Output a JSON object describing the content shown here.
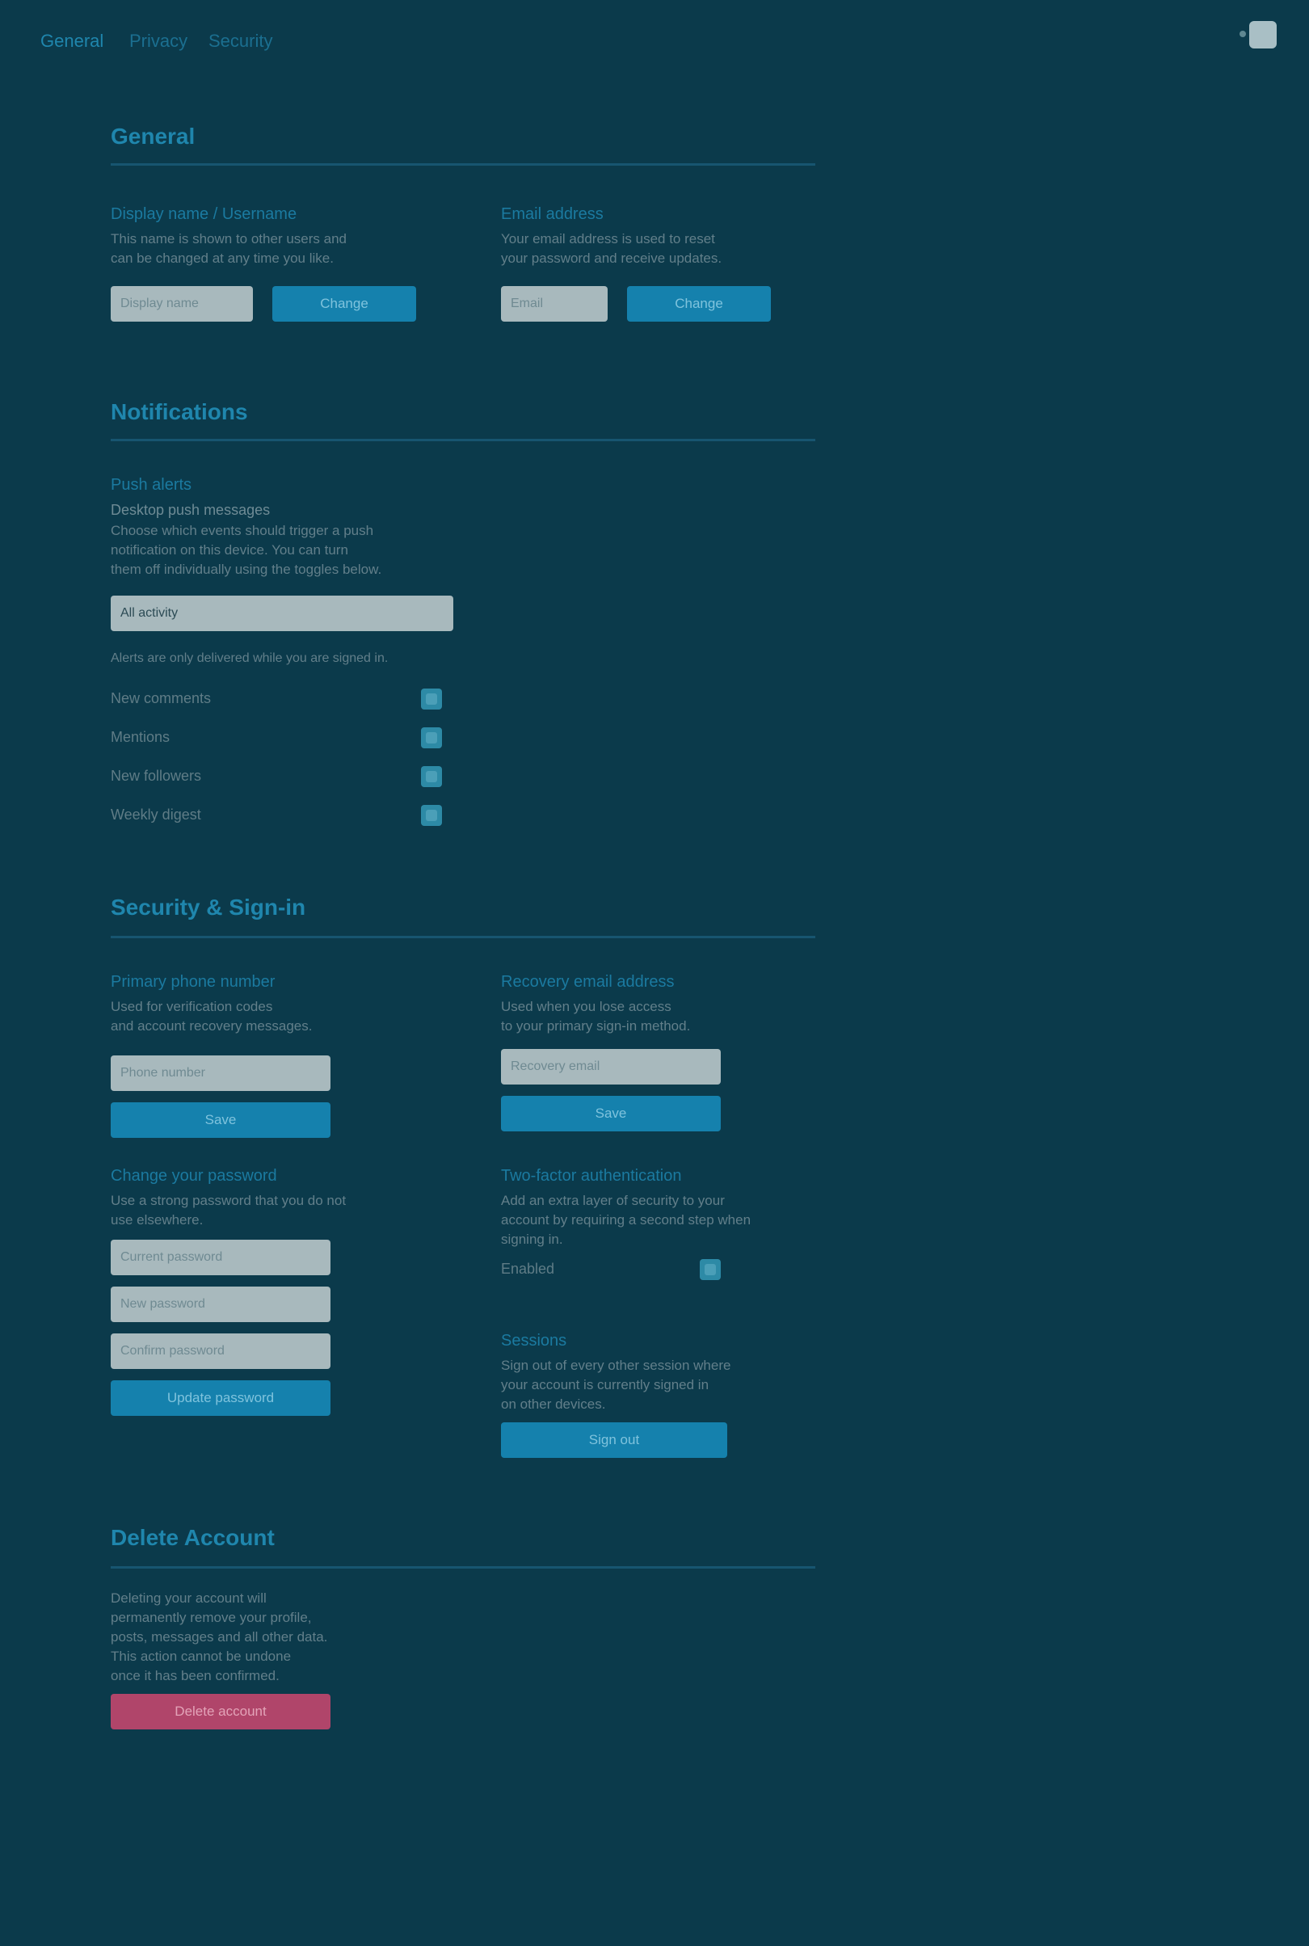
{
  "nav": {
    "links": [
      "General",
      "Privacy",
      "Security"
    ]
  },
  "general": {
    "title": "General",
    "display_name": {
      "heading": "Display name / Username",
      "desc": [
        "This name is shown to other users and",
        "can be changed at any time you like."
      ],
      "input_placeholder": "Display name",
      "button": "Change"
    },
    "email": {
      "heading": "Email address",
      "desc": [
        "Your email address is used to reset",
        "your password and receive updates."
      ],
      "input_placeholder": "Email",
      "button": "Change"
    }
  },
  "notifications": {
    "title": "Notifications",
    "push": {
      "heading": "Push alerts",
      "sub": "Desktop push messages",
      "desc": [
        "Choose which events should trigger a push",
        "notification on this device. You can turn",
        "them off individually using the toggles below."
      ],
      "select_value": "All activity",
      "note": "Alerts are only delivered while you are signed in."
    },
    "toggles": [
      {
        "label": "New comments",
        "on": true
      },
      {
        "label": "Mentions",
        "on": true
      },
      {
        "label": "New followers",
        "on": true
      },
      {
        "label": "Weekly digest",
        "on": true
      }
    ]
  },
  "security": {
    "title": "Security & Sign-in",
    "primary_phone": {
      "heading": "Primary phone number",
      "desc": [
        "Used for verification codes",
        "and account recovery messages."
      ],
      "input_placeholder": "Phone number",
      "button": "Save"
    },
    "recovery_email": {
      "heading": "Recovery email address",
      "desc": [
        "Used when you lose access",
        "to your primary sign-in method."
      ],
      "input_placeholder": "Recovery email",
      "button": "Save"
    },
    "change_password": {
      "heading": "Change your password",
      "desc": [
        "Use a strong password that you do not",
        "use elsewhere."
      ],
      "current_placeholder": "Current password",
      "new_placeholder": "New password",
      "confirm_placeholder": "Confirm password",
      "button": "Update password"
    },
    "two_factor": {
      "heading": "Two-factor authentication",
      "desc": [
        "Add an extra layer of security to your",
        "account by requiring a second step when",
        "signing in."
      ],
      "toggle_label": "Enabled",
      "toggle_on": true
    },
    "sessions": {
      "heading": "Sessions",
      "desc": [
        "Sign out of every other session where",
        "your account is currently signed in",
        "on other devices."
      ],
      "button": "Sign out"
    }
  },
  "delete_account": {
    "title": "Delete Account",
    "desc": [
      "Deleting your account will",
      "permanently remove your profile,",
      "posts, messages and all other data.",
      "This action cannot be undone",
      "once it has been confirmed."
    ],
    "button": "Delete account"
  },
  "colors": {
    "background": "#0b3a4b",
    "accent": "#1581ad",
    "danger": "#b0456a"
  }
}
